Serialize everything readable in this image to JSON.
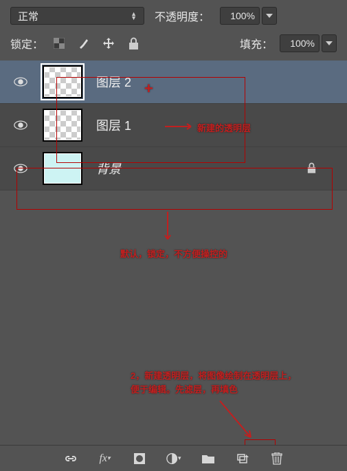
{
  "top": {
    "blend_mode": "正常",
    "opacity_label": "不透明度：",
    "opacity_value": "100%",
    "fill_label": "填充：",
    "fill_value": "100%",
    "lock_label": "锁定："
  },
  "layers": [
    {
      "name": "图层 2",
      "type": "transparent",
      "selected": true,
      "locked": false
    },
    {
      "name": "图层 1",
      "type": "transparent",
      "selected": false,
      "locked": false
    },
    {
      "name": "背景",
      "type": "solid",
      "selected": false,
      "locked": true,
      "italic": true
    }
  ],
  "annotations": {
    "a1_text": "新建的透明层",
    "a2_text": "默认，锁定，不方便操控的",
    "a3_text": "2，新建透明层，将图像绘制在透明层上，便于编辑。先滤层，再填色"
  },
  "icons": {
    "pixel": "pixel-lock-icon",
    "brush": "brush-icon",
    "move": "move-icon",
    "lock": "lock-icon"
  },
  "bottom_icons": [
    "link",
    "fx",
    "mask",
    "adjustment",
    "group",
    "new",
    "trash"
  ]
}
